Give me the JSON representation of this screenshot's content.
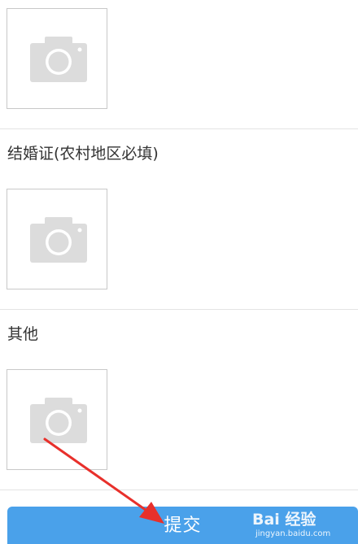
{
  "sections": [
    {
      "label": ""
    },
    {
      "label": "结婚证(农村地区必填)"
    },
    {
      "label": "其他"
    }
  ],
  "upload_placeholder_icon": "camera-icon",
  "submit": {
    "label": "提交"
  },
  "colors": {
    "submit_bg": "#4aa1ea",
    "annotation_arrow": "#e8302b",
    "placeholder_icon": "#dcdcdc",
    "divider": "#e3e3e3"
  },
  "watermark": {
    "main": "Bai 经验",
    "sub": "jingyan.baidu.com"
  }
}
